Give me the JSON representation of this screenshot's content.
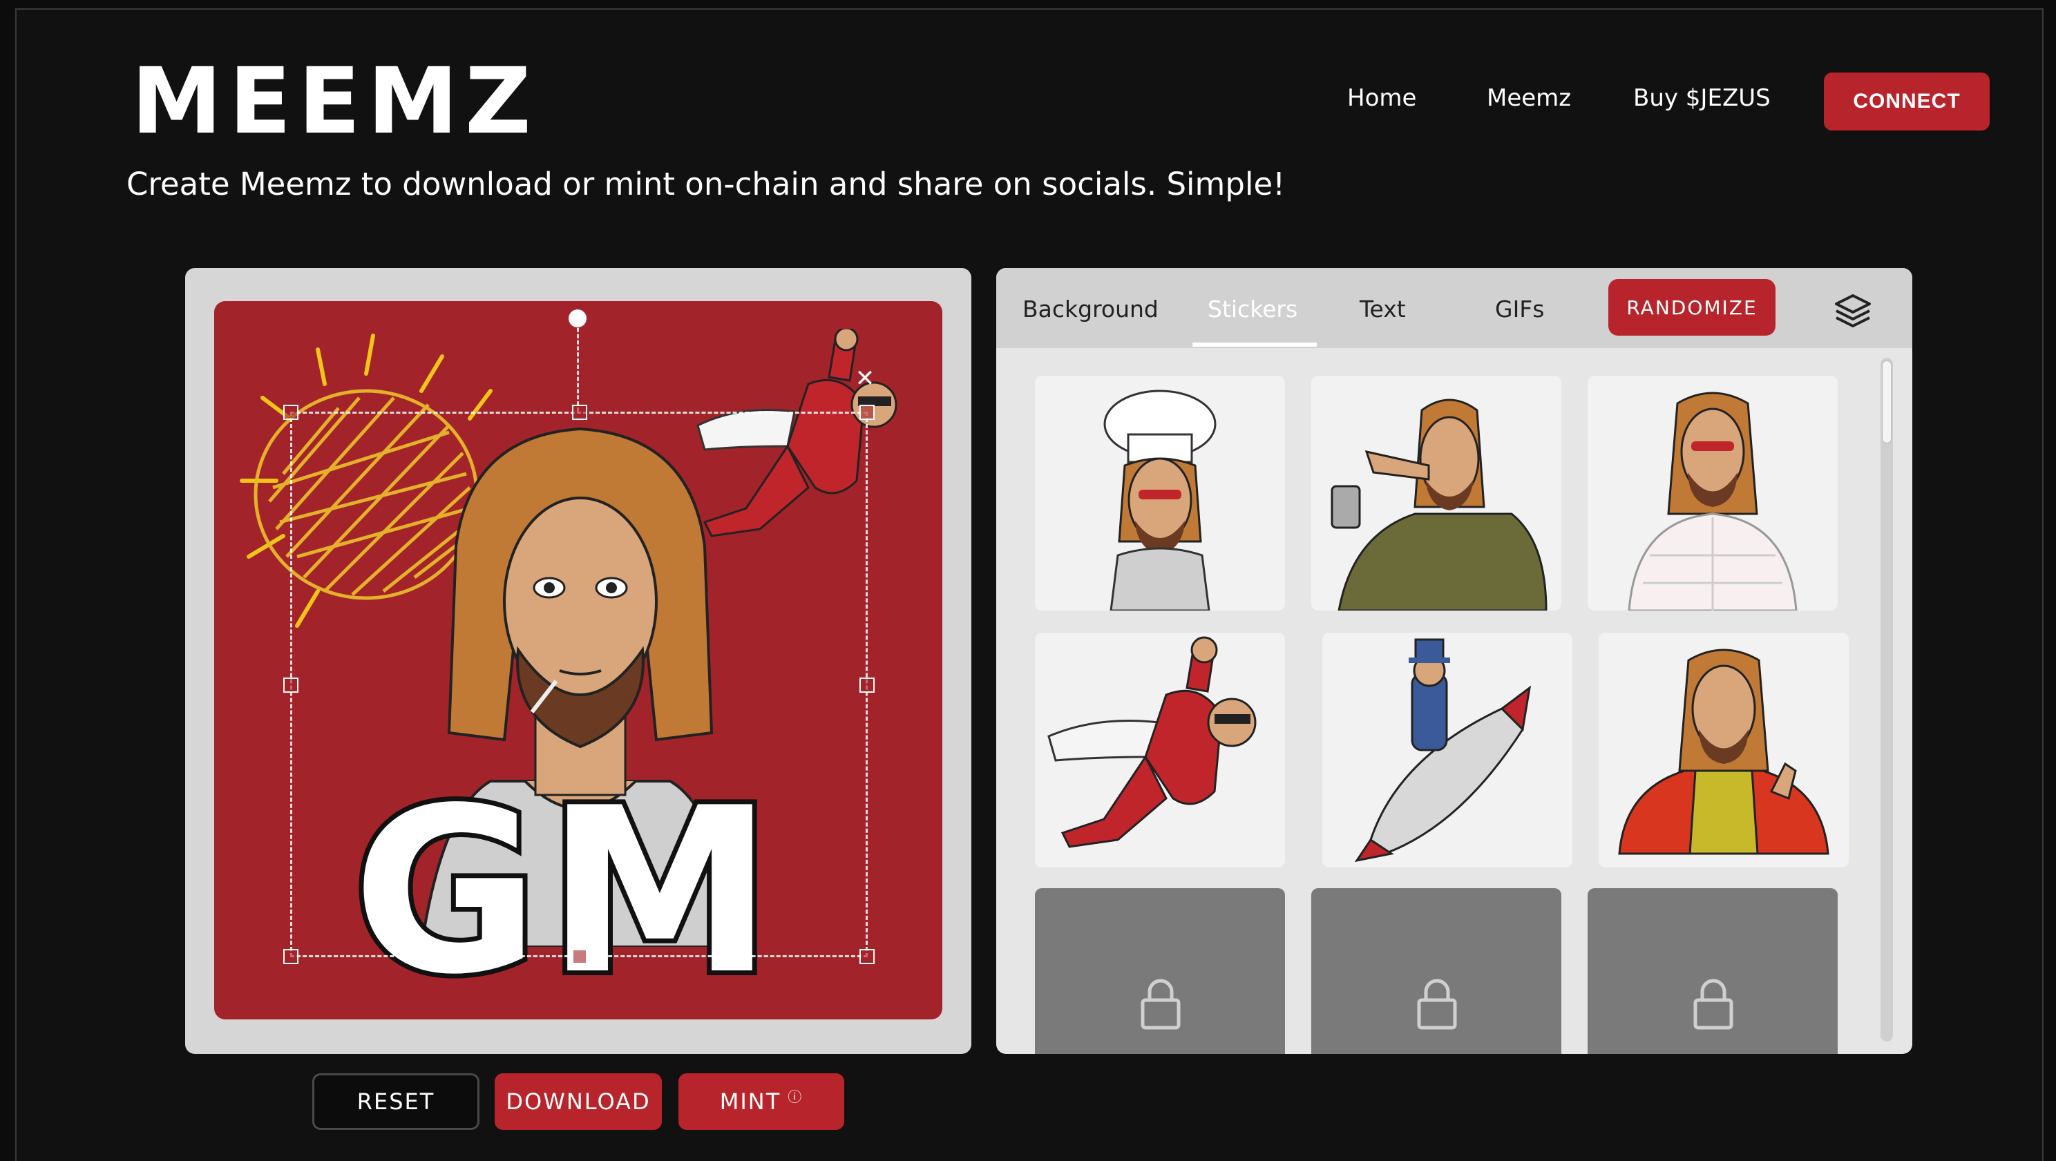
{
  "header": {
    "logo": "MEEMZ",
    "nav": [
      {
        "label": "Home"
      },
      {
        "label": "Meemz"
      },
      {
        "label": "Buy $JEZUS"
      }
    ],
    "connect_label": "CONNECT"
  },
  "tagline": "Create Meemz to download or mint on-chain and share on socials. Simple!",
  "editor": {
    "meme_text": "GM",
    "background_color": "#a3232a"
  },
  "actions": {
    "reset": "RESET",
    "download": "DOWNLOAD",
    "mint": "MINT",
    "mint_info": "ⓘ"
  },
  "panel": {
    "tabs": [
      {
        "label": "Background"
      },
      {
        "label": "Stickers"
      },
      {
        "label": "Text"
      },
      {
        "label": "GIFs"
      }
    ],
    "active_tab": "Stickers",
    "randomize": "RANDOMIZE",
    "stickers": [
      {
        "name": "chef-sticker"
      },
      {
        "name": "pointing-sticker"
      },
      {
        "name": "puffer-jacket-sticker"
      },
      {
        "name": "superhero-sticker"
      },
      {
        "name": "rocket-rider-sticker"
      },
      {
        "name": "red-jacket-sticker"
      },
      {
        "name": "locked"
      },
      {
        "name": "locked"
      },
      {
        "name": "locked"
      }
    ]
  },
  "colors": {
    "accent": "#b8242b",
    "page_bg": "#111111"
  }
}
